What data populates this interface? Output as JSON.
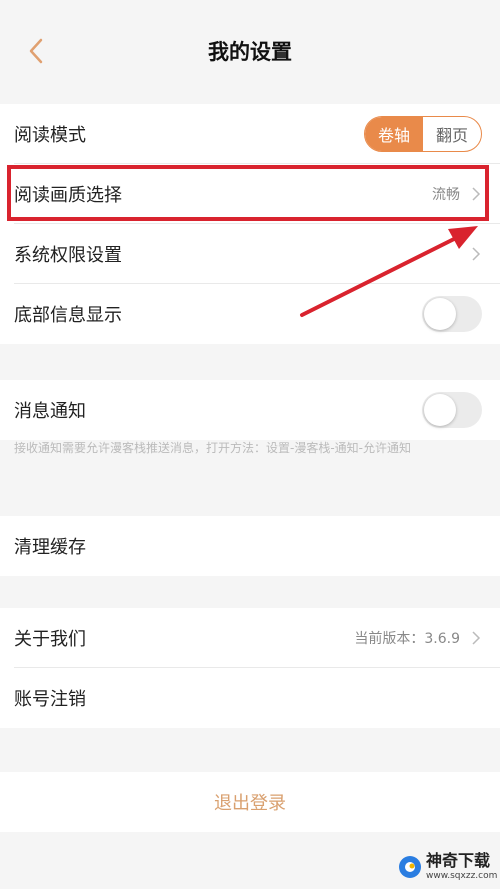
{
  "header": {
    "title": "我的设置"
  },
  "group1": {
    "reading_mode": {
      "label": "阅读模式",
      "options": [
        "卷轴",
        "翻页"
      ],
      "selected": "卷轴"
    },
    "quality": {
      "label": "阅读画质选择",
      "value": "流畅"
    },
    "permissions": {
      "label": "系统权限设置"
    },
    "bottom_info": {
      "label": "底部信息显示",
      "enabled": false
    }
  },
  "group2": {
    "notify": {
      "label": "消息通知",
      "enabled": false
    },
    "hint": "接收通知需要允许漫客栈推送消息，打开方法：设置-漫客栈-通知-允许通知"
  },
  "group3": {
    "clear_cache": {
      "label": "清理缓存"
    }
  },
  "group4": {
    "about": {
      "label": "关于我们",
      "value": "当前版本：3.6.9"
    },
    "deregister": {
      "label": "账号注销"
    }
  },
  "logout": {
    "label": "退出登录"
  },
  "watermark": {
    "name": "神奇下载",
    "url": "www.sqxzz.com"
  },
  "colors": {
    "accent": "#e98a4a",
    "annotation": "#d9232e",
    "logout_text": "#d9a06f"
  }
}
